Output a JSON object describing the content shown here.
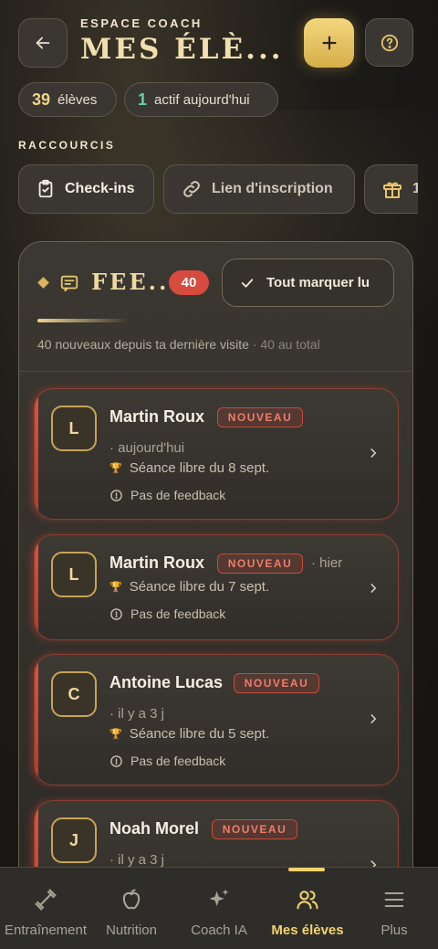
{
  "header": {
    "eyebrow": "ESPACE COACH",
    "title": "MES ÉLÈ..."
  },
  "stats": {
    "students_count": "39",
    "students_label": "élèves",
    "active_count": "1",
    "active_label": "actif aujourd'hui"
  },
  "shortcuts": {
    "section_label": "RACCOURCIS",
    "items": [
      {
        "label": "Check-ins",
        "icon": "clipboard-check-icon"
      },
      {
        "label": "Lien d'inscription",
        "icon": "link-icon"
      },
      {
        "label": "1",
        "icon": "gift-icon"
      }
    ]
  },
  "feed": {
    "title": "FEE...",
    "count": "40",
    "mark_all_label": "Tout marquer lu",
    "progress": 0.25,
    "summary_main": "40 nouveaux depuis ta dernière visite",
    "summary_total": "· 40 au total",
    "items": [
      {
        "initial": "L",
        "name": "Martin Roux",
        "badge": "NOUVEAU",
        "time": "· aujourd'hui",
        "session": "Séance libre du 8 sept.",
        "feedback": "Pas de feedback"
      },
      {
        "initial": "L",
        "name": "Martin Roux",
        "badge": "NOUVEAU",
        "time": "· hier",
        "session": "Séance libre du 7 sept.",
        "feedback": "Pas de feedback"
      },
      {
        "initial": "C",
        "name": "Antoine Lucas",
        "badge": "NOUVEAU",
        "time": "· il y a 3 j",
        "session": "Séance libre du 5 sept.",
        "feedback": "Pas de feedback"
      },
      {
        "initial": "J",
        "name": "Noah Morel",
        "badge": "NOUVEAU",
        "time": "· il y a 3 j"
      }
    ]
  },
  "nav": {
    "items": [
      {
        "label": "Entraînement",
        "icon": "dumbbell-icon"
      },
      {
        "label": "Nutrition",
        "icon": "apple-icon"
      },
      {
        "label": "Coach IA",
        "icon": "sparkles-icon"
      },
      {
        "label": "Mes élèves",
        "icon": "users-icon"
      },
      {
        "label": "Plus",
        "icon": "menu-icon"
      }
    ],
    "active": "Mes élèves"
  },
  "colors": {
    "accent": "#f2d36f",
    "gold_text": "#f1dfb0",
    "new_red": "#d74a3e",
    "active_green": "#5fd6a6"
  }
}
